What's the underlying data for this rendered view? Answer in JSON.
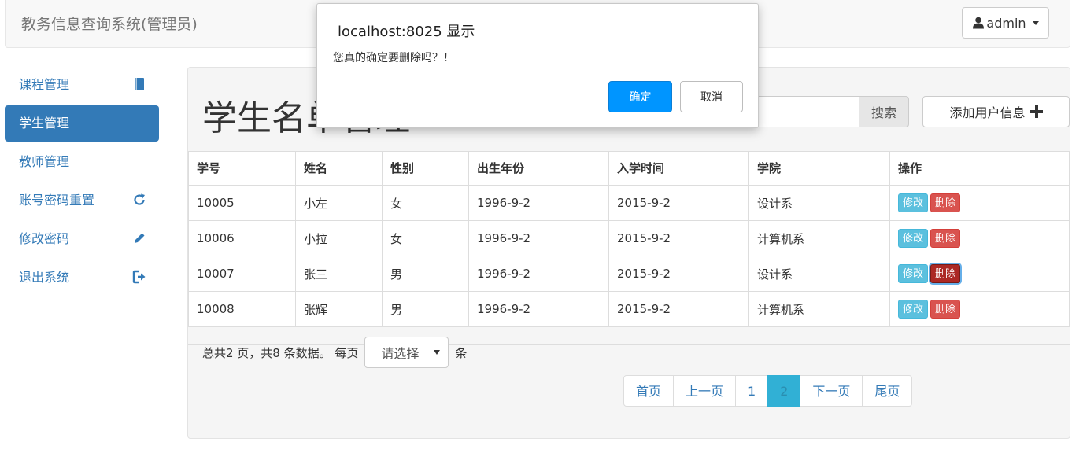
{
  "header": {
    "title": "教务信息查询系统(管理员)",
    "user": "admin"
  },
  "sidebar": {
    "items": [
      {
        "label": "课程管理",
        "icon": "book-icon"
      },
      {
        "label": "学生管理",
        "icon": ""
      },
      {
        "label": "教师管理",
        "icon": ""
      },
      {
        "label": "账号密码重置",
        "icon": "refresh-icon"
      },
      {
        "label": "修改密码",
        "icon": "pencil-icon"
      },
      {
        "label": "退出系统",
        "icon": "logout-icon"
      }
    ]
  },
  "main": {
    "title": "学生名单管理",
    "search_value": "",
    "search_label": "搜索",
    "add_label": "添加用户信息",
    "table": {
      "headers": [
        "学号",
        "姓名",
        "性别",
        "出生年份",
        "入学时间",
        "学院",
        "操作"
      ],
      "rows": [
        [
          "10005",
          "小左",
          "女",
          "1996-9-2",
          "2015-9-2",
          "设计系"
        ],
        [
          "10006",
          "小拉",
          "女",
          "1996-9-2",
          "2015-9-2",
          "计算机系"
        ],
        [
          "10007",
          "张三",
          "男",
          "1996-9-2",
          "2015-9-2",
          "设计系"
        ],
        [
          "10008",
          "张辉",
          "男",
          "1996-9-2",
          "2015-9-2",
          "计算机系"
        ]
      ],
      "edit_label": "修改",
      "delete_label": "删除"
    },
    "pager": {
      "summary": "总共2 页，共8 条数据。 每页",
      "page_size_value": "请选择",
      "unit": "条",
      "links": [
        "首页",
        "上一页",
        "1",
        "2",
        "下一页",
        "尾页"
      ],
      "active": "2"
    }
  },
  "dialog": {
    "title": "localhost:8025 显示",
    "message": "您真的确定要删除吗？！",
    "ok_label": "确定",
    "cancel_label": "取消"
  },
  "colors": {
    "primary": "#337ab7",
    "info": "#5bc0de",
    "danger": "#d9534f",
    "dialog_ok": "#0095ff"
  }
}
